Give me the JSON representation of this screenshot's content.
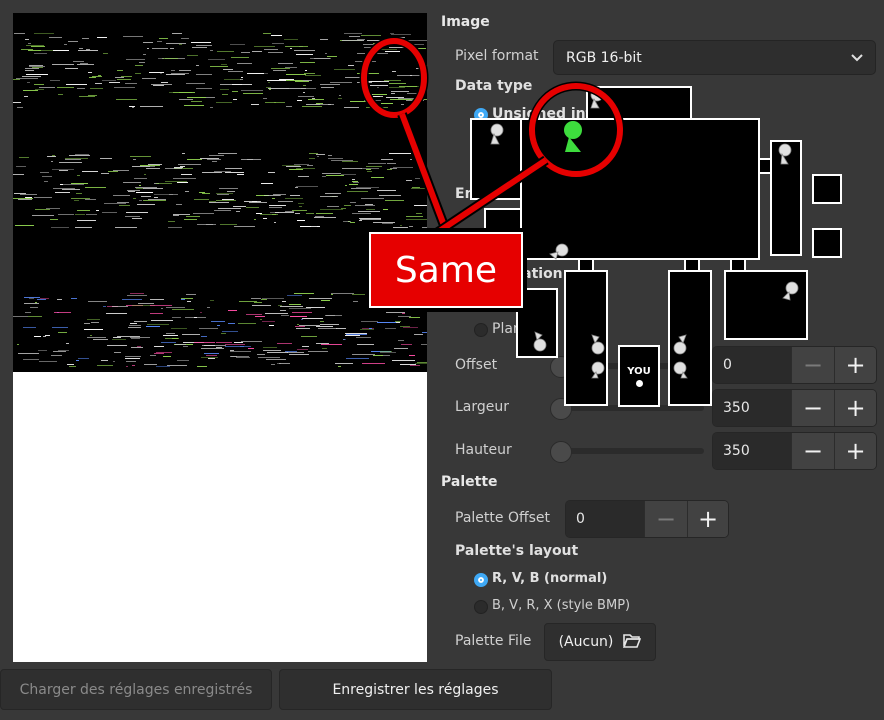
{
  "image_section": {
    "title": "Image",
    "pixel_format_label": "Pixel format",
    "pixel_format_value": "RGB 16-bit",
    "data_type_title": "Data type",
    "data_type_option": "Unsigned int",
    "endianness_title": "Endianness",
    "configuration_title": "Configuration",
    "planar_label": "Planar",
    "offset_label": "Offset",
    "offset_value": "0",
    "width_label": "Largeur",
    "width_value": "350",
    "height_label": "Hauteur",
    "height_value": "350"
  },
  "palette_section": {
    "title": "Palette",
    "offset_label": "Palette Offset",
    "offset_value": "0",
    "layout_title": "Palette's layout",
    "layout_options": [
      "R, V, B (normal)",
      "B, V, R, X (style BMP)"
    ],
    "file_label": "Palette File",
    "file_value": "(Aucun)"
  },
  "bottom": {
    "load_button": "Charger des réglages enregistrés",
    "save_button": "Enregistrer les réglages"
  },
  "overlay": {
    "annotation": "Same",
    "you_label": "YOU",
    "annotation_color": "#e60000",
    "pin_color": "#3ddc3d"
  }
}
